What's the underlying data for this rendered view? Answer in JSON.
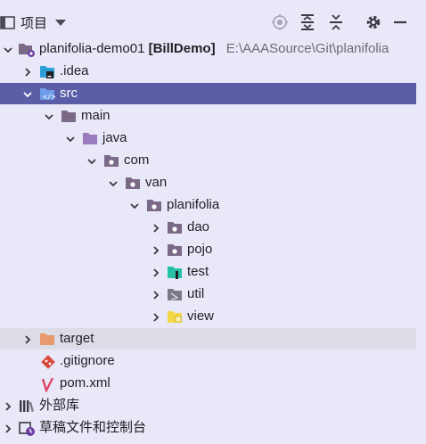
{
  "toolbar": {
    "title": "项目",
    "icons": [
      "select-opened-file-icon",
      "expand-all-icon",
      "collapse-all-icon",
      "gear-icon",
      "minimize-icon"
    ]
  },
  "tree": {
    "project": {
      "name": "planifolia-demo01",
      "module": "[BillDemo]",
      "path": "E:\\AAASource\\Git\\planifolia"
    },
    "idea": ".idea",
    "src": "src",
    "main": "main",
    "java": "java",
    "com": "com",
    "van": "van",
    "planifolia": "planifolia",
    "dao": "dao",
    "pojo": "pojo",
    "test": "test",
    "util": "util",
    "view": "view",
    "target": "target",
    "gitignore": ".gitignore",
    "pom": "pom.xml",
    "external_libs": "外部库",
    "scratches": "草稿文件和控制台"
  },
  "colors": {
    "selection": "#5b5ea6",
    "folder": "#7a6a88",
    "accent_folder": "#9b7bc0",
    "target_folder": "#e69a6d"
  }
}
